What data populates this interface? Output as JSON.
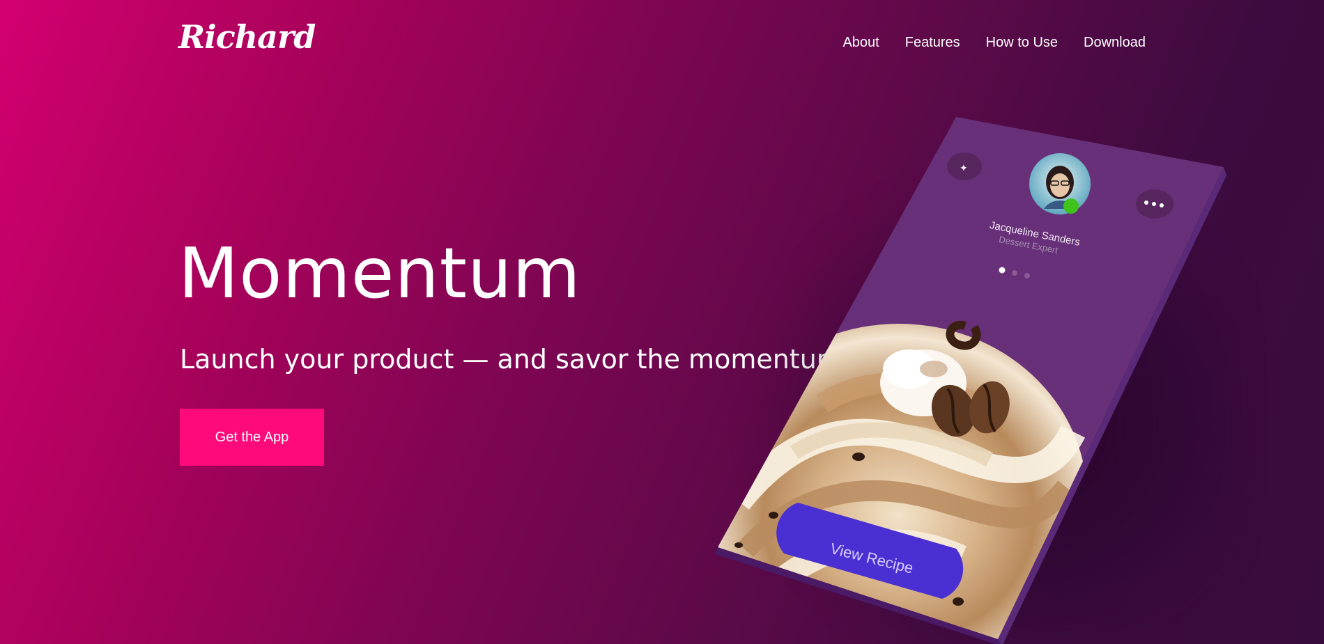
{
  "brand": {
    "logo_text": "Richard"
  },
  "nav": {
    "items": [
      {
        "label": "About"
      },
      {
        "label": "Features"
      },
      {
        "label": "How to Use"
      },
      {
        "label": "Download"
      }
    ]
  },
  "hero": {
    "title": "Momentum",
    "subtitle": "Launch your product — and savor the momentum.",
    "cta_label": "Get the App"
  },
  "phone_card": {
    "profile_name": "Jacqueline Sanders",
    "profile_role": "Dessert Expert",
    "action_label": "View Recipe",
    "carousel_active_index": 0,
    "carousel_count": 3,
    "left_icon": "star-icon",
    "right_icon": "more-dots-icon",
    "status": "online"
  },
  "colors": {
    "cta": "#ff0a7a",
    "card": "#683078",
    "action_button": "#4a2fd2",
    "status_dot": "#3ec41a"
  }
}
